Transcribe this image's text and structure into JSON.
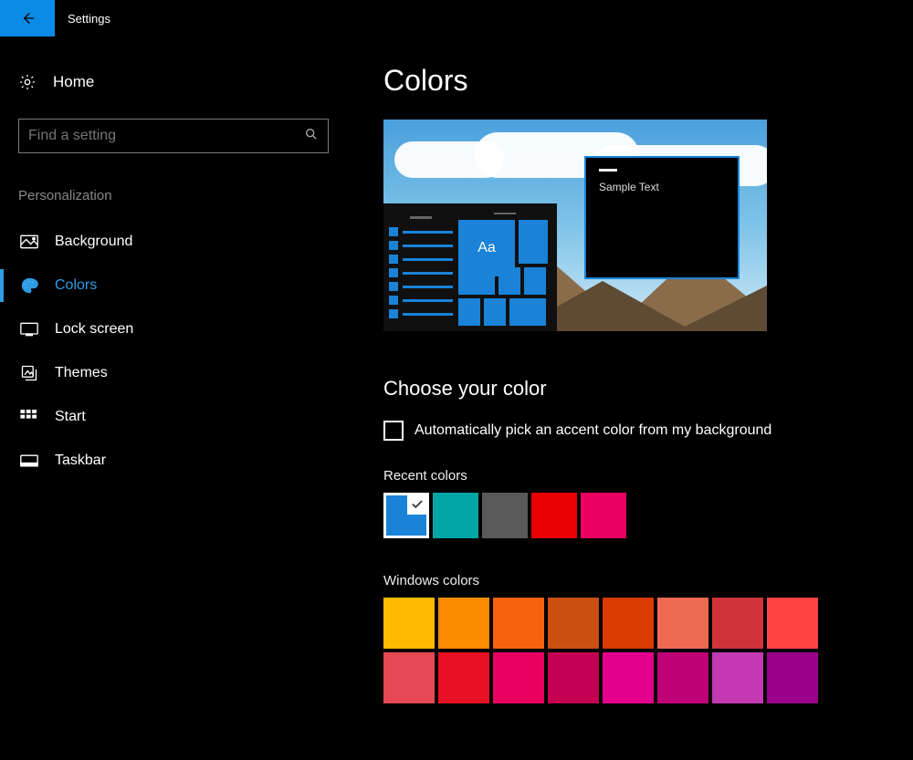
{
  "titlebar": {
    "title": "Settings"
  },
  "sidebar": {
    "home_label": "Home",
    "search_placeholder": "Find a setting",
    "section_label": "Personalization",
    "items": [
      {
        "id": "background",
        "label": "Background",
        "active": false
      },
      {
        "id": "colors",
        "label": "Colors",
        "active": true
      },
      {
        "id": "lockscreen",
        "label": "Lock screen",
        "active": false
      },
      {
        "id": "themes",
        "label": "Themes",
        "active": false
      },
      {
        "id": "start",
        "label": "Start",
        "active": false
      },
      {
        "id": "taskbar",
        "label": "Taskbar",
        "active": false
      }
    ]
  },
  "content": {
    "page_title": "Colors",
    "preview": {
      "sample_text": "Sample Text",
      "tile_text": "Aa"
    },
    "choose_color": {
      "heading": "Choose your color",
      "auto_pick_label": "Automatically pick an accent color from my background",
      "auto_pick_checked": false,
      "recent_label": "Recent colors",
      "recent_colors": [
        {
          "hex": "#1a83d8",
          "selected": true
        },
        {
          "hex": "#00a6a6",
          "selected": false
        },
        {
          "hex": "#5a5a5a",
          "selected": false
        },
        {
          "hex": "#e60000",
          "selected": false
        },
        {
          "hex": "#ea005e",
          "selected": false
        }
      ],
      "windows_colors_label": "Windows colors",
      "windows_colors_rows": [
        [
          "#ffb900",
          "#ff8c00",
          "#f7630c",
          "#ca5010",
          "#da3b01",
          "#ef6950",
          "#d13438",
          "#ff4343"
        ],
        [
          "#e74856",
          "#e81123",
          "#ea005e",
          "#c30052",
          "#e3008c",
          "#bf0077",
          "#c239b3",
          "#9a0089"
        ]
      ]
    }
  },
  "accent_color": "#1a83d8"
}
